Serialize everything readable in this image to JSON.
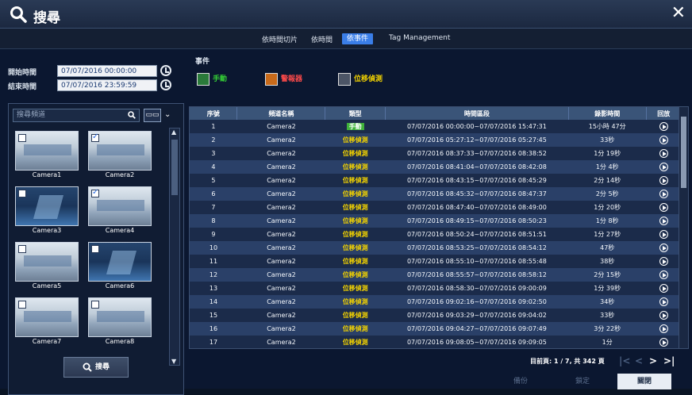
{
  "window": {
    "title": "搜尋",
    "close_label": "✕"
  },
  "tabs": [
    {
      "label": "依時間切片",
      "active": false
    },
    {
      "label": "依時間",
      "active": false
    },
    {
      "label": "依事件",
      "active": true
    },
    {
      "label": "Tag Management",
      "active": false
    }
  ],
  "time_filter": {
    "start_label": "開始時間",
    "start_value": "07/07/2016 00:00:00",
    "end_label": "結束時間",
    "end_value": "07/07/2016 23:59:59"
  },
  "channel_search": {
    "placeholder": "搜尋頻道",
    "layout_label": "▭▭",
    "dropdown_label": "⌄"
  },
  "cameras": [
    {
      "name": "Camera1",
      "checked": false
    },
    {
      "name": "Camera2",
      "checked": true
    },
    {
      "name": "Camera3",
      "checked": false
    },
    {
      "name": "Camera4",
      "checked": true
    },
    {
      "name": "Camera5",
      "checked": false
    },
    {
      "name": "Camera6",
      "checked": false
    },
    {
      "name": "Camera7",
      "checked": false
    },
    {
      "name": "Camera8",
      "checked": false
    }
  ],
  "search_button": "搜尋",
  "events": {
    "label": "事件",
    "types": [
      {
        "label": "手動",
        "color": "#35d135"
      },
      {
        "label": "警報器",
        "color": "#ff4a4a"
      },
      {
        "label": "位移偵測",
        "color": "#f2d200"
      }
    ]
  },
  "table": {
    "headers": [
      "序號",
      "頻道名稱",
      "類型",
      "時間區段",
      "錄影時間",
      "回放"
    ],
    "rows": [
      {
        "no": "1",
        "channel": "Camera2",
        "type": "手動",
        "period": "07/07/2016 00:00:00~07/07/2016 15:47:31",
        "duration": "15小時 47分"
      },
      {
        "no": "2",
        "channel": "Camera2",
        "type": "位移偵測",
        "period": "07/07/2016 05:27:12~07/07/2016 05:27:45",
        "duration": "33秒"
      },
      {
        "no": "3",
        "channel": "Camera2",
        "type": "位移偵測",
        "period": "07/07/2016 08:37:33~07/07/2016 08:38:52",
        "duration": "1分 19秒"
      },
      {
        "no": "4",
        "channel": "Camera2",
        "type": "位移偵測",
        "period": "07/07/2016 08:41:04~07/07/2016 08:42:08",
        "duration": "1分 4秒"
      },
      {
        "no": "5",
        "channel": "Camera2",
        "type": "位移偵測",
        "period": "07/07/2016 08:43:15~07/07/2016 08:45:29",
        "duration": "2分 14秒"
      },
      {
        "no": "6",
        "channel": "Camera2",
        "type": "位移偵測",
        "period": "07/07/2016 08:45:32~07/07/2016 08:47:37",
        "duration": "2分 5秒"
      },
      {
        "no": "7",
        "channel": "Camera2",
        "type": "位移偵測",
        "period": "07/07/2016 08:47:40~07/07/2016 08:49:00",
        "duration": "1分 20秒"
      },
      {
        "no": "8",
        "channel": "Camera2",
        "type": "位移偵測",
        "period": "07/07/2016 08:49:15~07/07/2016 08:50:23",
        "duration": "1分 8秒"
      },
      {
        "no": "9",
        "channel": "Camera2",
        "type": "位移偵測",
        "period": "07/07/2016 08:50:24~07/07/2016 08:51:51",
        "duration": "1分 27秒"
      },
      {
        "no": "10",
        "channel": "Camera2",
        "type": "位移偵測",
        "period": "07/07/2016 08:53:25~07/07/2016 08:54:12",
        "duration": "47秒"
      },
      {
        "no": "11",
        "channel": "Camera2",
        "type": "位移偵測",
        "period": "07/07/2016 08:55:10~07/07/2016 08:55:48",
        "duration": "38秒"
      },
      {
        "no": "12",
        "channel": "Camera2",
        "type": "位移偵測",
        "period": "07/07/2016 08:55:57~07/07/2016 08:58:12",
        "duration": "2分 15秒"
      },
      {
        "no": "13",
        "channel": "Camera2",
        "type": "位移偵測",
        "period": "07/07/2016 08:58:30~07/07/2016 09:00:09",
        "duration": "1分 39秒"
      },
      {
        "no": "14",
        "channel": "Camera2",
        "type": "位移偵測",
        "period": "07/07/2016 09:02:16~07/07/2016 09:02:50",
        "duration": "34秒"
      },
      {
        "no": "15",
        "channel": "Camera2",
        "type": "位移偵測",
        "period": "07/07/2016 09:03:29~07/07/2016 09:04:02",
        "duration": "33秒"
      },
      {
        "no": "16",
        "channel": "Camera2",
        "type": "位移偵測",
        "period": "07/07/2016 09:04:27~07/07/2016 09:07:49",
        "duration": "3分 22秒"
      },
      {
        "no": "17",
        "channel": "Camera2",
        "type": "位移偵測",
        "period": "07/07/2016 09:08:05~07/07/2016 09:09:05",
        "duration": "1分"
      }
    ]
  },
  "pager": {
    "text": "目前頁: 1 / 7, 共 342 頁",
    "first": "|<",
    "prev": "<",
    "next": ">",
    "last": ">|"
  },
  "bottom_buttons": {
    "backup": "備份",
    "lock": "鎖定",
    "close": "關閉"
  }
}
